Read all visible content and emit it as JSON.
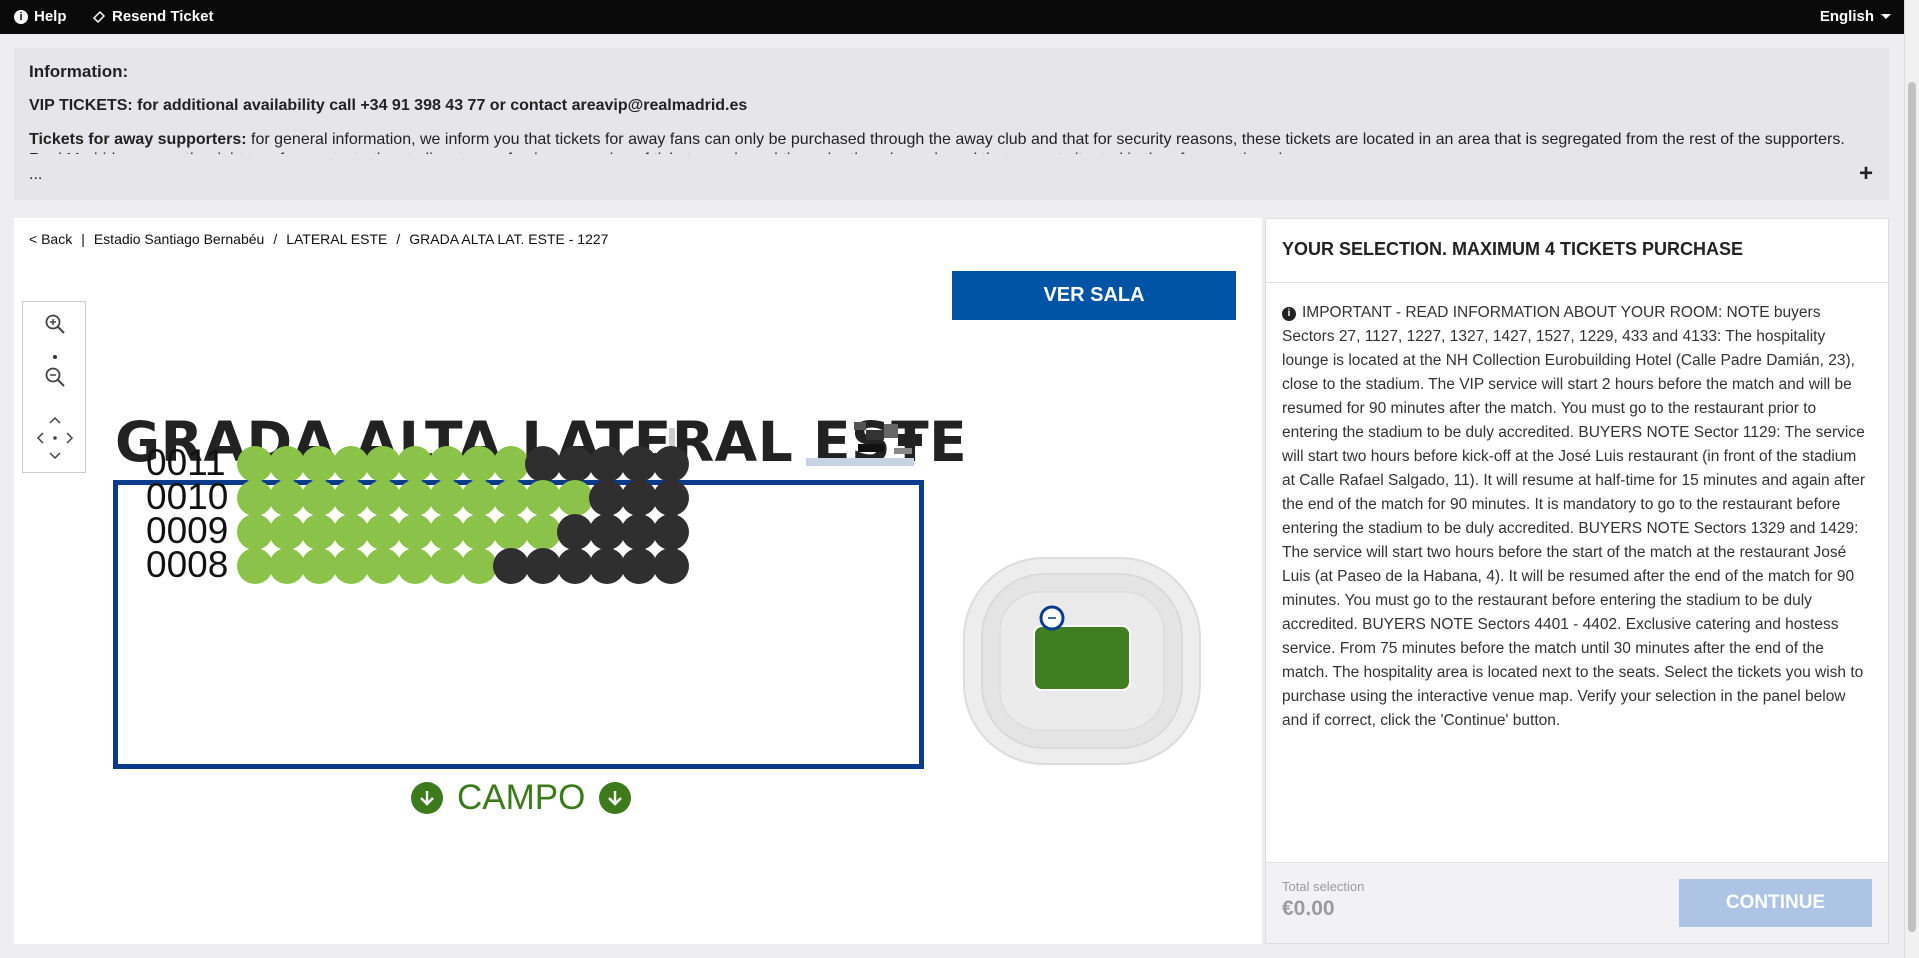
{
  "topbar": {
    "help_label": "Help",
    "resend_label": "Resend Ticket",
    "language": "English"
  },
  "info": {
    "heading": "Information:",
    "vip_text": "VIP TICKETS: for additional availability call +34 91 398 43 77 or contact areavip@realmadrid.es",
    "away_label": "Tickets for away supporters:",
    "away_text": " for general information, we inform you that tickets for away fans can only be purchased through the away club and that for security reasons, these tickets are located in an area that is segregated from the rest of the supporters. Real Madrid reserves the right to refuse entry to the stadium to any fan in possession of tickets purchased through other channels and that are not situated in the aforementioned areas.",
    "more": "...",
    "expand": "+"
  },
  "breadcrumb": {
    "back": "< Back",
    "sep1": "|",
    "venue": "Estadio Santiago Bernabéu",
    "sep2": "/",
    "zone": "LATERAL ESTE",
    "sep3": "/",
    "sector": "GRADA ALTA LAT. ESTE - 1227"
  },
  "ver_sala": "VER SALA",
  "section_title": "GRADA ALTA LATERAL ESTE",
  "field_label": "CAMPO",
  "rows": [
    {
      "label": "0011",
      "seats": [
        "free",
        "free",
        "free",
        "free",
        "free",
        "free",
        "free",
        "free",
        "free",
        "taken",
        "taken",
        "taken",
        "taken",
        "taken"
      ]
    },
    {
      "label": "0010",
      "seats": [
        "free",
        "free",
        "free",
        "free",
        "free",
        "free",
        "free",
        "free",
        "free",
        "free",
        "free",
        "taken",
        "taken",
        "taken"
      ]
    },
    {
      "label": "0009",
      "seats": [
        "free",
        "free",
        "free",
        "free",
        "free",
        "free",
        "free",
        "free",
        "free",
        "free",
        "taken",
        "taken",
        "taken",
        "taken"
      ]
    },
    {
      "label": "0008",
      "seats": [
        "free",
        "free",
        "free",
        "free",
        "free",
        "free",
        "free",
        "free",
        "taken",
        "taken",
        "taken",
        "taken",
        "taken",
        "taken"
      ]
    }
  ],
  "selection": {
    "header": "YOUR SELECTION. MAXIMUM 4 TICKETS PURCHASE",
    "notice": "IMPORTANT - READ INFORMATION ABOUT YOUR ROOM: NOTE buyers Sectors 27, 1127, 1227, 1327, 1427, 1527, 1229, 433 and 4133: The hospitality lounge is located at the NH Collection Eurobuilding Hotel (Calle Padre Damián, 23), close to the stadium. The VIP service will start 2 hours before the match and will be resumed for 90 minutes after the match. You must go to the restaurant prior to entering the stadium to be duly accredited. BUYERS NOTE Sector 1129: The service will start two hours before kick-off at the José Luis restaurant (in front of the stadium at Calle Rafael Salgado, 11). It will resume at half-time for 15 minutes and again after the end of the match for 90 minutes. It is mandatory to go to the restaurant before entering the stadium to be duly accredited. BUYERS NOTE Sectors 1329 and 1429: The service will start two hours before the start of the match at the restaurant José Luis (at Paseo de la Habana, 4). It will be resumed after the end of the match for 90 minutes. You must go to the restaurant before entering the stadium to be duly accredited. BUYERS NOTE Sectors 4401 - 4402. Exclusive catering and hostess service. From 75 minutes before the match until 30 minutes after the end of the match. The hospitality area is located next to the seats. Select the tickets you wish to purchase using the interactive venue map. Verify your selection in the panel below and if correct, click the 'Continue' button.",
    "total_label": "Total selection",
    "total_value": "€0.00",
    "continue_label": "CONTINUE"
  },
  "colors": {
    "seat_free": "#8bc34a",
    "seat_taken": "#2f2f2f",
    "frame": "#0a3a8c",
    "primary_button": "#0053a5",
    "field_green": "#3d7a1c"
  }
}
